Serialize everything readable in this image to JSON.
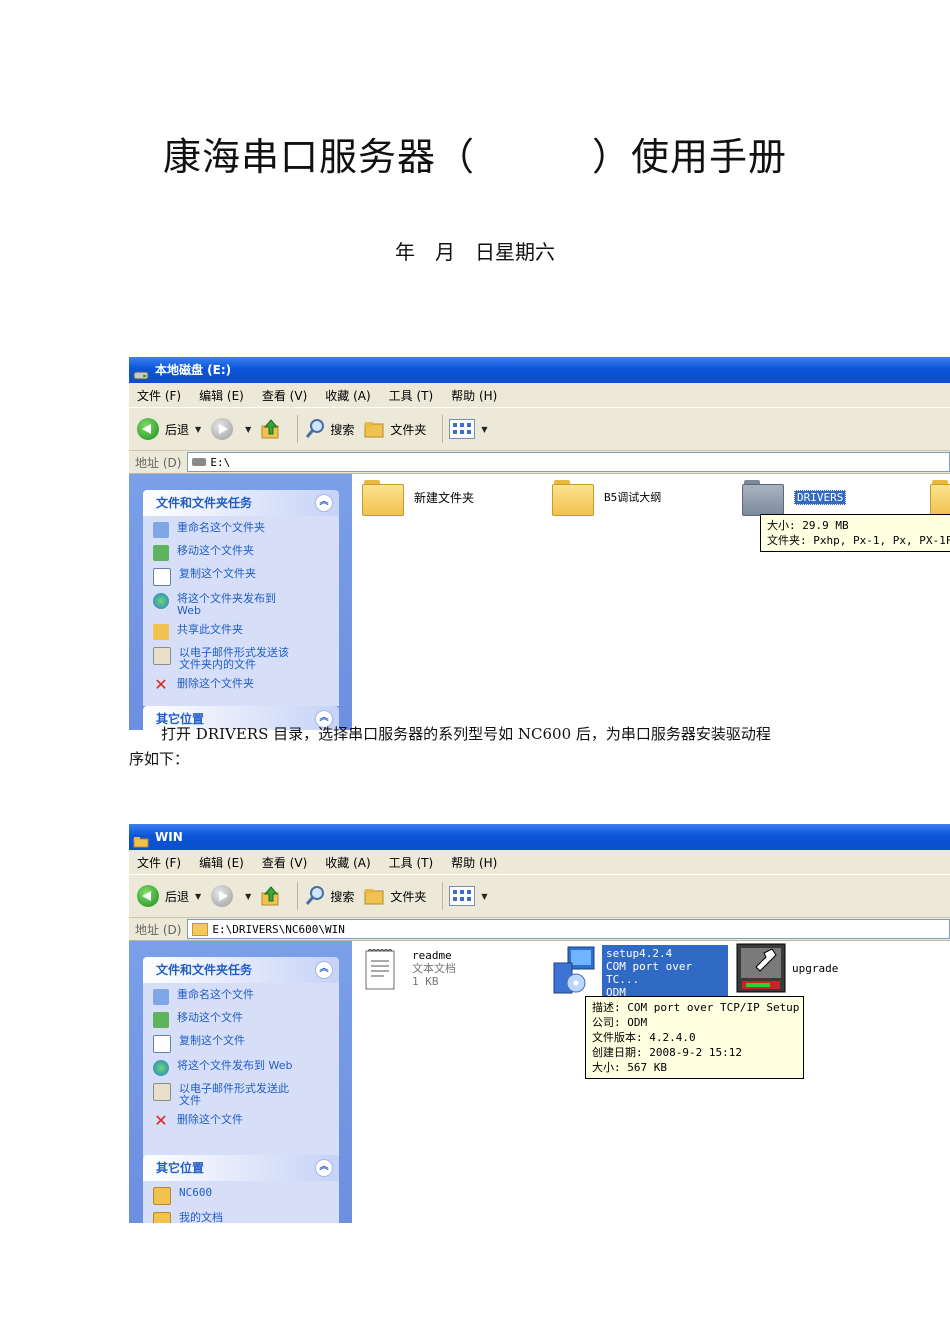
{
  "doc": {
    "title": "康海串口服务器（　　　）使用手册",
    "date": "年　月　日星期六",
    "para_line1": "打开 DRIVERS 目录，选择串口服务器的系列型号如 NC600 后，为串口服务器安装驱动程",
    "para_line2": "序如下："
  },
  "menu": {
    "file": "文件 (F)",
    "edit": "编辑 (E)",
    "view": "查看 (V)",
    "fav": "收藏 (A)",
    "tools": "工具 (T)",
    "help": "帮助 (H)"
  },
  "toolbar": {
    "back": "后退",
    "search": "搜索",
    "folders": "文件夹"
  },
  "address_label": "地址 (D)",
  "win1": {
    "title": "本地磁盘 (E:)",
    "address": "E:\\",
    "task_title": "文件和文件夹任务",
    "tasks": [
      "重命名这个文件夹",
      "移动这个文件夹",
      "复制这个文件夹",
      "将这个文件夹发布到",
      "Web",
      "共享此文件夹",
      "以电子邮件形式发送该",
      "文件夹内的文件",
      "删除这个文件夹"
    ],
    "other_title": "其它位置",
    "items": [
      "新建文件夹",
      "B5调试大纲",
      "DRIVERS"
    ],
    "tooltip_size": "大小: 29.9 MB",
    "tooltip_folders": "文件夹: Pxhp, Px-1, Px, PX-1F"
  },
  "win2": {
    "title": "WIN",
    "address": "E:\\DRIVERS\\NC600\\WIN",
    "task_title": "文件和文件夹任务",
    "tasks": [
      "重命名这个文件",
      "移动这个文件",
      "复制这个文件",
      "将这个文件发布到 Web",
      "以电子邮件形式发送此",
      "文件",
      "删除这个文件"
    ],
    "other_title": "其它位置",
    "others": [
      "NC600",
      "我的文档"
    ],
    "readme": {
      "name": "readme",
      "type": "文本文档",
      "size": "1 KB"
    },
    "setup": {
      "name": "setup4.2.4",
      "desc": "COM port over TC...",
      "company": "ODM"
    },
    "upgrade": "upgrade",
    "tooltip": [
      "描述: COM port over TCP/IP Setup",
      "公司: ODM",
      "文件版本: 4.2.4.0",
      "创建日期: 2008-9-2 15:12",
      "大小: 567 KB"
    ]
  }
}
